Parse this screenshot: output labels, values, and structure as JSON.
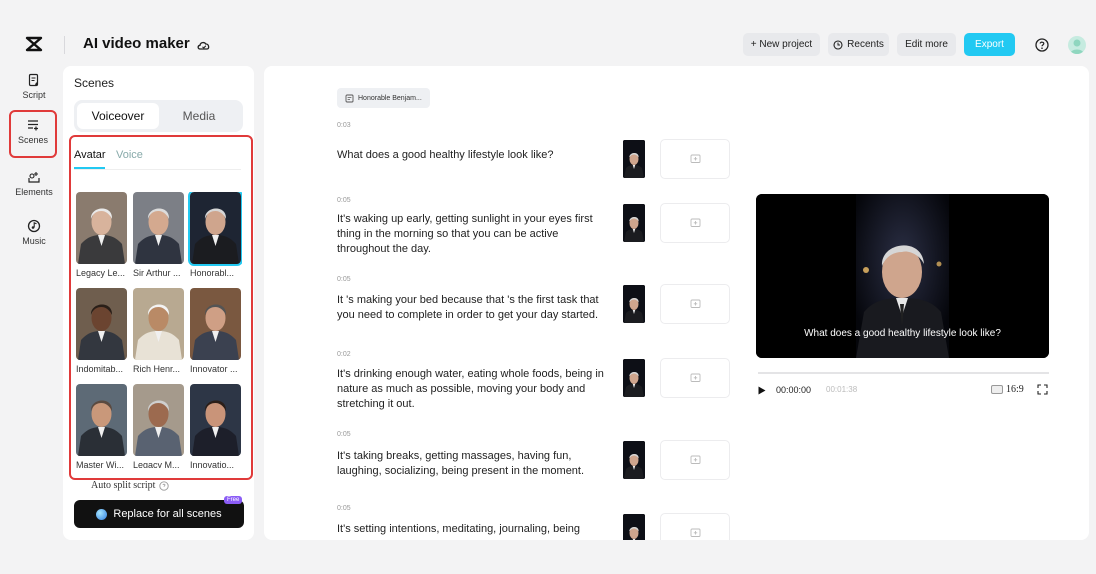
{
  "header": {
    "app_title": "AI video maker",
    "new_project": "+ New project",
    "recents": "Recents",
    "edit_more": "Edit more",
    "export": "Export"
  },
  "rail": [
    {
      "label": "Script",
      "icon": "script-icon"
    },
    {
      "label": "Scenes",
      "icon": "scenes-icon",
      "active": true
    },
    {
      "label": "Elements",
      "icon": "elements-icon"
    },
    {
      "label": "Music",
      "icon": "music-icon"
    }
  ],
  "scenes_panel": {
    "title": "Scenes",
    "tabs": [
      "Voiceover",
      "Media"
    ],
    "sub_tabs": [
      "Avatar",
      "Voice"
    ],
    "avatars": [
      {
        "name": "Legacy Le..."
      },
      {
        "name": "Sir Arthur ..."
      },
      {
        "name": "Honorabl...",
        "selected": true
      },
      {
        "name": "Indomitab..."
      },
      {
        "name": "Rich Henr..."
      },
      {
        "name": "Innovator ..."
      },
      {
        "name": "Master Wi..."
      },
      {
        "name": "Legacy M..."
      },
      {
        "name": "Innovatio..."
      }
    ],
    "auto_split": "Auto split script",
    "replace_button": "Replace for all scenes",
    "free_badge": "Free"
  },
  "script": {
    "speaker": "Honorable Benjam...",
    "scenes": [
      {
        "time": "0:03",
        "text": "What does a good healthy lifestyle look like?"
      },
      {
        "time": "0:05",
        "text": "It's waking up early, getting sunlight in your eyes first thing in the morning so that you can be active throughout the day."
      },
      {
        "time": "0:05",
        "text": "It 's making your bed because that 's the first task that you need to complete in order to get your day started."
      },
      {
        "time": "0:02",
        "text": "It's drinking enough water, eating whole foods, being in nature as much as possible, moving your body and stretching it out."
      },
      {
        "time": "0:05",
        "text": "It's taking breaks, getting massages, having fun, laughing, socializing, being present in the moment."
      },
      {
        "time": "0:05",
        "text": "It's setting intentions, meditating, journaling, being"
      }
    ]
  },
  "preview": {
    "caption": "What does a good healthy lifestyle look like?",
    "time_current": "00:00:00",
    "time_total": "00:01:38",
    "aspect_ratio": "16:9",
    "progress": 0
  }
}
